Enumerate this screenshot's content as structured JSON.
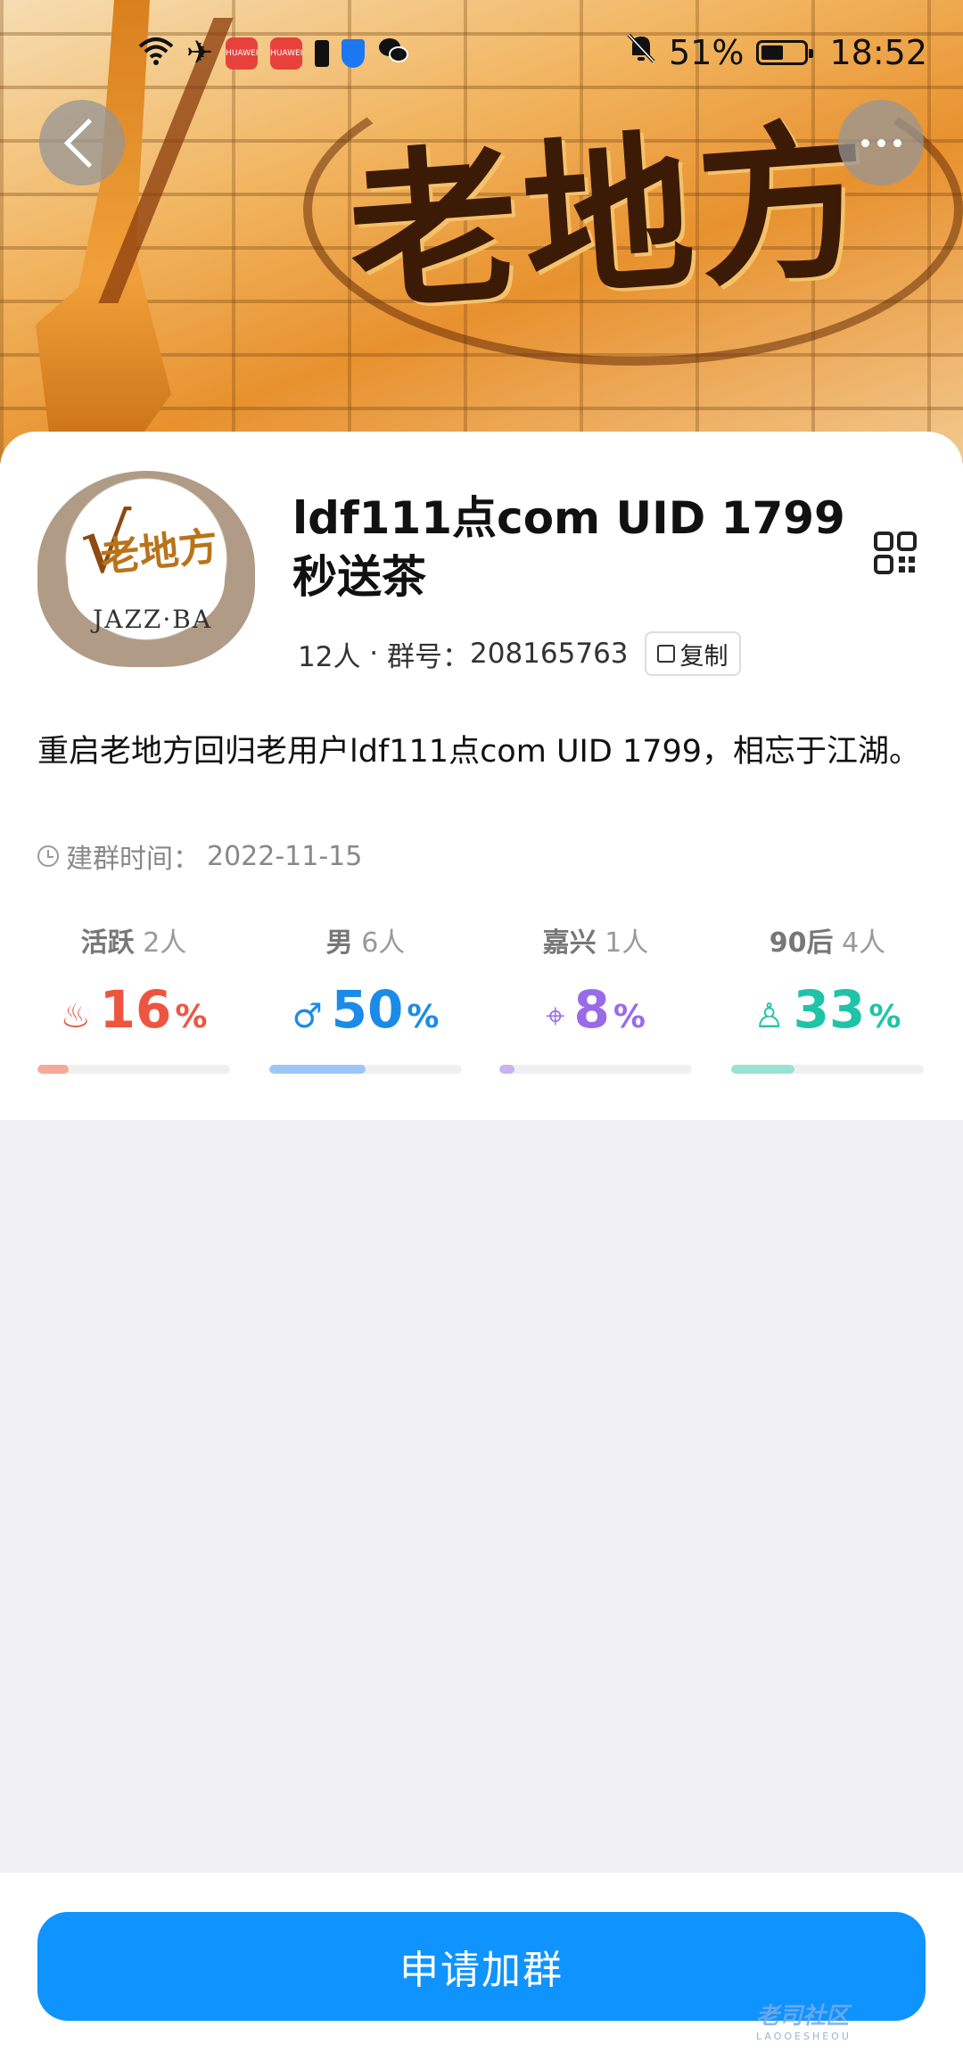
{
  "status_bar": {
    "app_badges": [
      "HUAWEI",
      "HUAWEI"
    ],
    "battery": "51%",
    "battery_level": 0.51,
    "time": "18:52"
  },
  "banner": {
    "logo_text": "老地方"
  },
  "group": {
    "name": "ldf111点com  UID 1799 秒送茶",
    "member_count": "12人",
    "separator": " · ",
    "id_label": "群号：",
    "id": "208165763",
    "copy_label": "复制",
    "avatar_text": "老地方",
    "avatar_subtext": "JAZZ·BA",
    "description": "重启老地方回归老用户ldf111点com   UID 1799，相忘于江湖。",
    "created_label": "建群时间：",
    "created_date": "2022-11-15"
  },
  "stats": [
    {
      "title": "活跃",
      "count": "2人",
      "icon": "flame-icon",
      "glyph": "♨",
      "value": "16",
      "unit": "%",
      "color": "#ee5541",
      "bar_color": "#f5a99b",
      "fraction": 0.16
    },
    {
      "title": "男",
      "count": "6人",
      "icon": "male-icon",
      "glyph": "♂",
      "value": "50",
      "unit": "%",
      "color": "#1c8be8",
      "bar_color": "#9dc6f7",
      "fraction": 0.5
    },
    {
      "title": "嘉兴",
      "count": "1人",
      "icon": "location-pin-icon",
      "glyph": "⌖",
      "value": "8",
      "unit": "%",
      "color": "#9a6be8",
      "bar_color": "#c7b2f2",
      "fraction": 0.08
    },
    {
      "title": "90后",
      "count": "4人",
      "icon": "person-icon",
      "glyph": "♙",
      "value": "33",
      "unit": "%",
      "color": "#1fc4a8",
      "bar_color": "#98e2d4",
      "fraction": 0.33
    }
  ],
  "actions": {
    "join_label": "申请加群"
  },
  "watermark": {
    "text": "老司社区",
    "sub": "LAOOESHEOU"
  }
}
